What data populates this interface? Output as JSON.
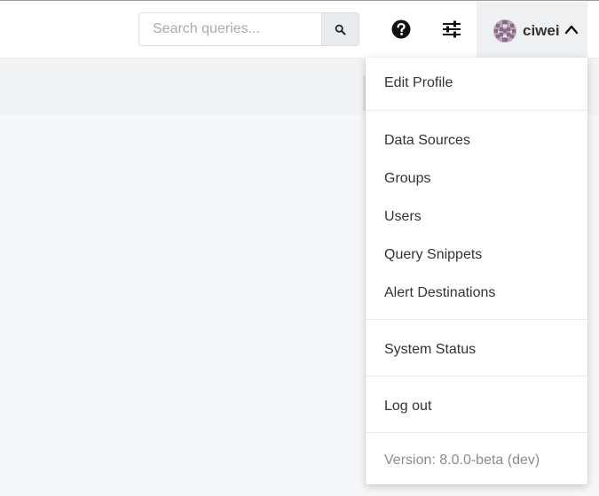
{
  "header": {
    "search": {
      "placeholder": "Search queries..."
    },
    "user": {
      "name": "ciwei"
    }
  },
  "menu": {
    "profile_item": "Edit Profile",
    "settings_items": [
      "Data Sources",
      "Groups",
      "Users",
      "Query Snippets",
      "Alert Destinations"
    ],
    "system_status": "System Status",
    "logout": "Log out",
    "version": "Version: 8.0.0-beta (dev)"
  },
  "icons": {
    "search": "search-icon",
    "help": "question-circle-icon",
    "settings": "sliders-icon",
    "avatar": "identicon-avatar",
    "chevron": "chevron-up-icon"
  },
  "colors": {
    "header_bg": "#ffffff",
    "page_bg": "#f6f7f9",
    "profile_active_bg": "#eef0f2",
    "version_text": "#888d93"
  }
}
